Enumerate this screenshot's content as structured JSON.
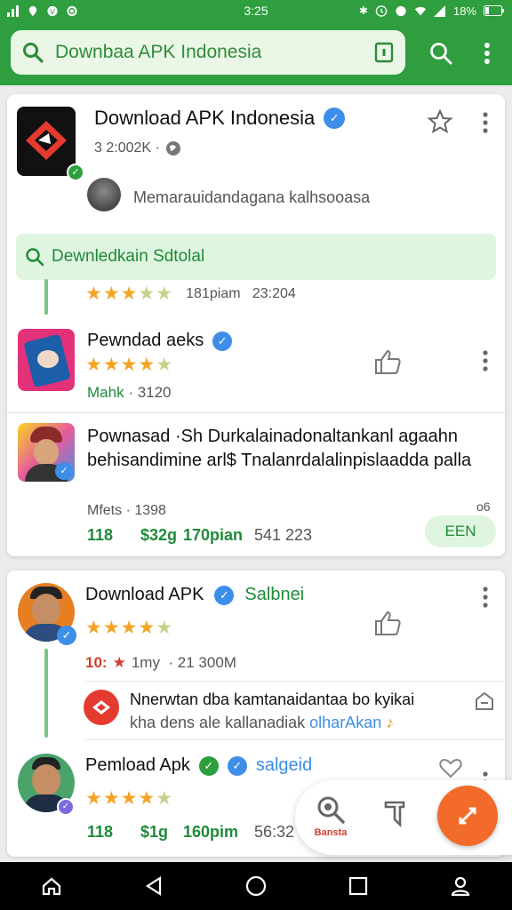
{
  "status": {
    "time": "3:25",
    "battery": "18%"
  },
  "search": {
    "text": "Downbaa APK Indonesia"
  },
  "card1": {
    "title": "Download APK Indonesia",
    "meta": "3 2:002K ·",
    "comment": "Memarauidandagana kalhsooasa",
    "highlight": "Dewnledkain Sdtolal",
    "sub_rating_meta": "181piam   23:204",
    "item1": {
      "title": "Pewndad aeks",
      "meta_green": "Mahk",
      "meta": "· 3120"
    },
    "item2": {
      "title": "Pownasad ·Sh Durkalainadonaltankanl agaahn behisandimine arl$ Tnalanrdalalinpislaadda palla",
      "meta": "Mfets · 1398",
      "right_small": "o6",
      "stats": [
        "118",
        "$32g",
        "170pian",
        "541 223"
      ],
      "button": "EEN"
    }
  },
  "card2": {
    "item1": {
      "title": "Download APK",
      "tag": "Salbnei"
    },
    "sub": {
      "num": "10:",
      "rest": "1my  · 21 300M"
    },
    "comment": {
      "line1": "Nnerwtan dba kamtanaidantaa bo kyikai",
      "line2": "kha dens ale kallanadiak",
      "link": "olharAkan"
    },
    "item2": {
      "title": "Pemload Apk",
      "tag": "salgeid",
      "stats": [
        "118",
        "$1g",
        "160pim",
        "56:32"
      ]
    }
  },
  "fab": {
    "search_label": "Bansta"
  },
  "colors": {
    "primary": "#2e9e3e",
    "accent": "#f26b2a",
    "star": "#f4a425",
    "verified": "#3d8ee8"
  }
}
